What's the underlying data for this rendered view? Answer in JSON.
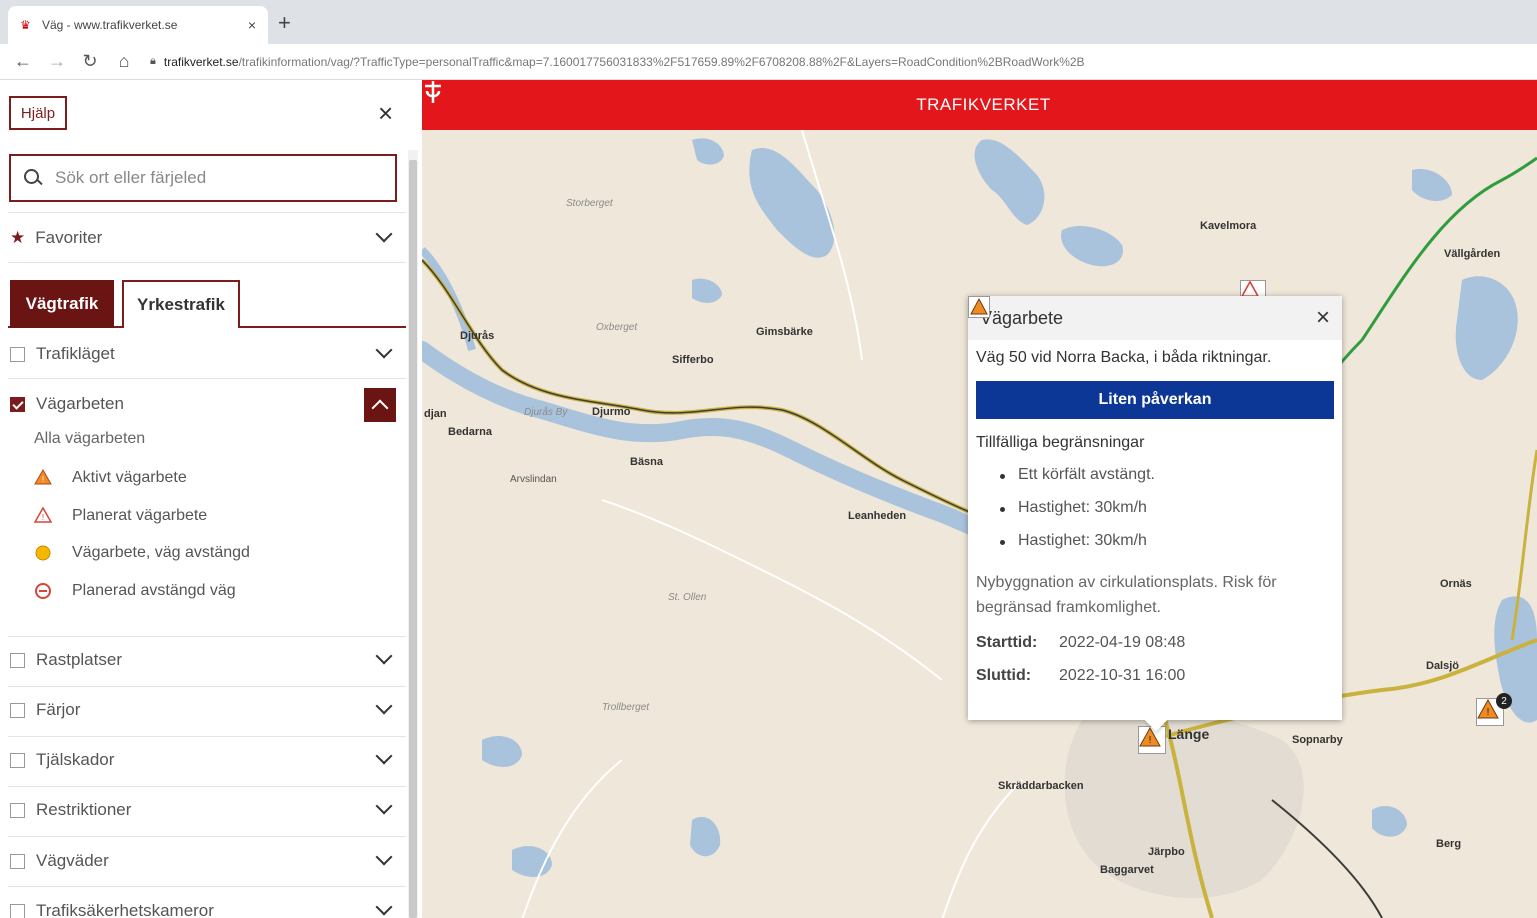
{
  "browser": {
    "tab_title": "Väg - www.trafikverket.se",
    "tab_close": "×",
    "new_tab": "+",
    "url_host": "trafikverket.se",
    "url_path": "/trafikinformation/vag/?TrafficType=personalTraffic&map=7.160017756031833%2F517659.89%2F6708208.88%2F&Layers=RoadCondition%2BRoadWork%2B"
  },
  "sidebar": {
    "help_label": "Hjälp",
    "close_label": "×",
    "search_placeholder": "Sök ort eller färjeled",
    "favorites_label": "Favoriter",
    "tabs": {
      "active": "Vägtrafik",
      "inactive": "Yrkestrafik"
    },
    "trafiklaget_label": "Trafikläget",
    "vagarbeten_label": "Vägarbeten",
    "vagarbeten_sub": "Alla vägarbeten",
    "legend": [
      {
        "label": "Aktivt vägarbete",
        "icon": "roadwork-active-icon"
      },
      {
        "label": "Planerat vägarbete",
        "icon": "roadwork-planned-icon"
      },
      {
        "label": "Vägarbete, väg avstängd",
        "icon": "roadwork-closed-icon"
      },
      {
        "label": "Planerad avstängd väg",
        "icon": "planned-closed-road-icon"
      }
    ],
    "layers": [
      {
        "label": "Rastplatser"
      },
      {
        "label": "Färjor"
      },
      {
        "label": "Tjälskador"
      },
      {
        "label": "Restriktioner"
      },
      {
        "label": "Vägväder"
      },
      {
        "label": "Trafiksäkerhetskameror"
      }
    ]
  },
  "map": {
    "brand": "TRAFIKVERKET",
    "places": {
      "djuras": "Djurås",
      "djurmo": "Djurmo",
      "sifferbo": "Sifferbo",
      "basna": "Bäsna",
      "bedarna": "Bedarna",
      "arvslindan": "Arvslindan",
      "leanheden": "Leanheden",
      "gimsbarke": "Gimsbärke",
      "kavelmora": "Kavelmora",
      "vallgarden": "Vällgården",
      "ornas": "Ornäs",
      "dalsjo": "Dalsjö",
      "lange": "Länge",
      "sopnarby": "Sopnarby",
      "skraddarbacken": "Skräddarbacken",
      "jarpbo": "Järpbo",
      "baggarvet": "Baggarvet",
      "berg": "Berg",
      "ljan": "djan",
      "djurasby": "Djurås By",
      "oxberget": "Oxberget",
      "stolen": "St. Ollen",
      "trollberget": "Trollberget",
      "storberget": "Storberget"
    },
    "cluster_count": "2"
  },
  "popup": {
    "title": "Vägarbete",
    "close": "×",
    "road": "Väg 50 vid Norra Backa, i båda riktningar.",
    "impact": "Liten påverkan",
    "restrictions_title": "Tillfälliga begränsningar",
    "restrictions": [
      "Ett körfält avstängt.",
      "Hastighet: 30km/h",
      "Hastighet: 30km/h"
    ],
    "description": "Nybyggnation av cirkulationsplats. Risk för begränsad framkomlighet.",
    "start_label": "Starttid:",
    "start_value": "2022-04-19 08:48",
    "end_label": "Sluttid:",
    "end_value": "2022-10-31 16:00"
  },
  "colors": {
    "brand_red": "#e3161b",
    "maroon": "#6b1414",
    "impact_blue": "#0c3797",
    "map_land": "#efe7d9",
    "water": "#a9c3dc"
  }
}
